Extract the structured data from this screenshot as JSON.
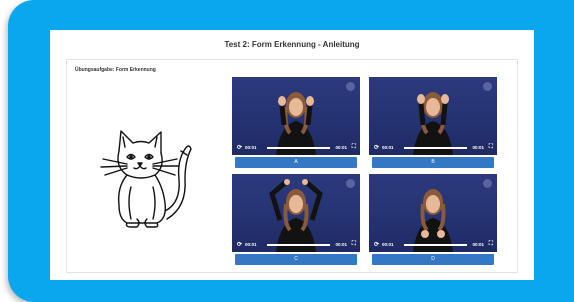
{
  "page": {
    "title": "Test 2: Form Erkennung - Anleitung",
    "task_label": "Übungsaufgabe: Form Erkennung"
  },
  "colors": {
    "frame": "#0aa6ee",
    "button": "#3477c4",
    "video_bg": "#263373"
  },
  "videos": [
    {
      "time_current": "00:01",
      "time_total": "00:01",
      "option_label": "A",
      "icons": [
        "replay-icon",
        "fullscreen-icon"
      ]
    },
    {
      "time_current": "00:01",
      "time_total": "00:01",
      "option_label": "B",
      "icons": [
        "replay-icon",
        "fullscreen-icon"
      ]
    },
    {
      "time_current": "00:01",
      "time_total": "00:01",
      "option_label": "C",
      "icons": [
        "replay-icon",
        "fullscreen-icon"
      ]
    },
    {
      "time_current": "00:01",
      "time_total": "00:01",
      "option_label": "D",
      "icons": [
        "replay-icon",
        "fullscreen-icon"
      ]
    }
  ]
}
